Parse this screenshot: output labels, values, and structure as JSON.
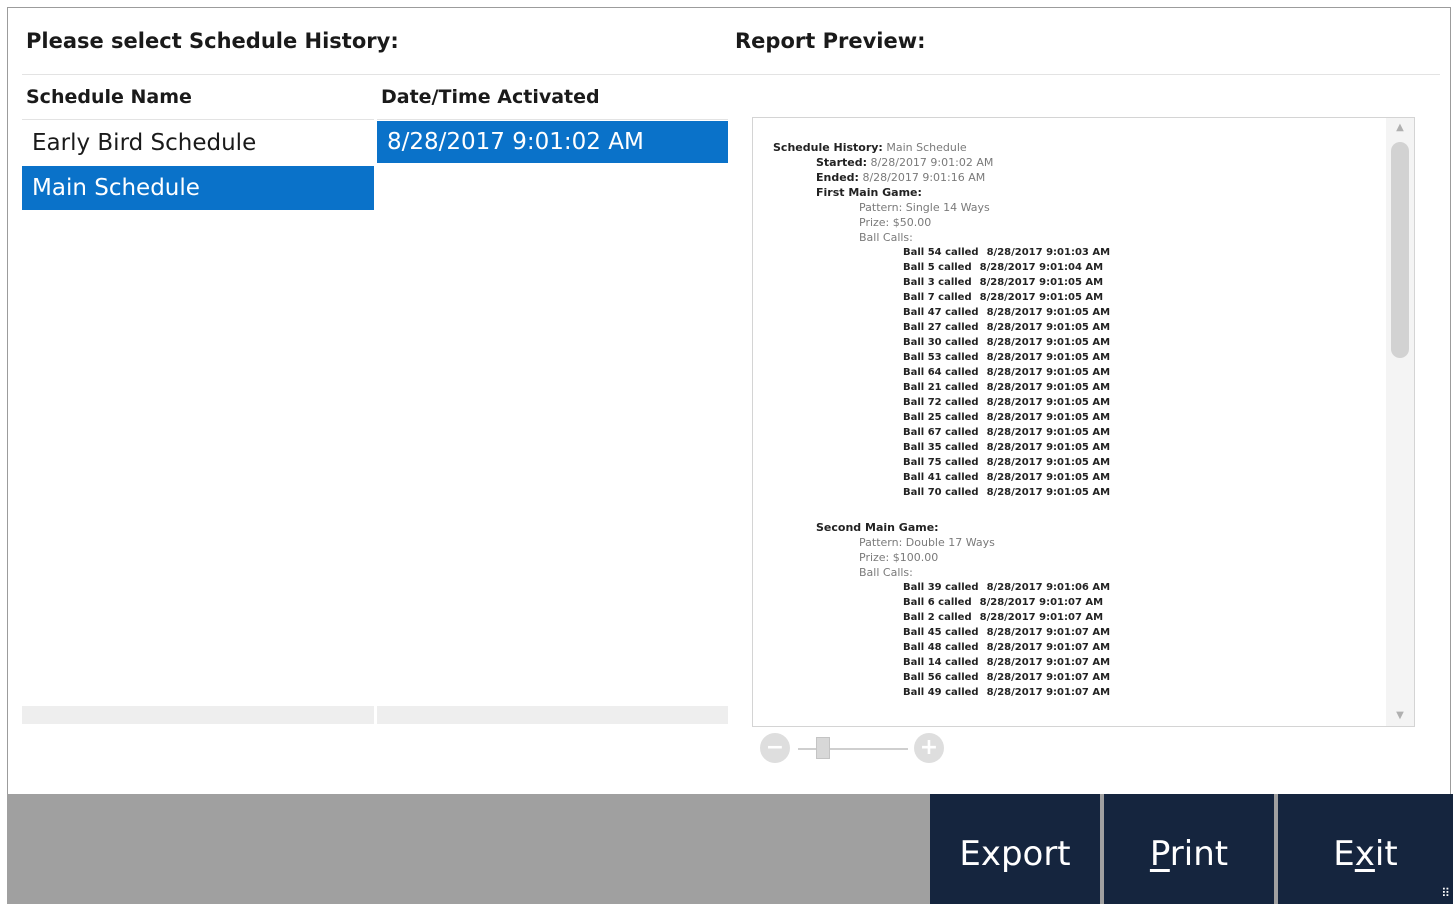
{
  "left_panel": {
    "title": "Please select Schedule History:",
    "columns": {
      "name": "Schedule Name",
      "date": "Date/Time Activated"
    },
    "schedules": [
      "Early Bird Schedule",
      "Main Schedule"
    ],
    "selected_schedule_index": 1,
    "activations": [
      "8/28/2017 9:01:02 AM"
    ],
    "selected_activation_index": 0
  },
  "preview": {
    "title": "Report Preview:",
    "report": {
      "history_label": "Schedule History:",
      "history_value": "Main Schedule",
      "started_label": "Started:",
      "started_value": "8/28/2017 9:01:02 AM",
      "ended_label": "Ended:",
      "ended_value": "8/28/2017 9:01:16 AM",
      "games": [
        {
          "title": "First Main Game:",
          "pattern": "Pattern: Single 14 Ways",
          "prize": "Prize: $50.00",
          "ball_calls_label": "Ball Calls:",
          "calls": [
            {
              "ball": "Ball 54 called",
              "time": "8/28/2017 9:01:03 AM"
            },
            {
              "ball": "Ball 5 called",
              "time": "8/28/2017 9:01:04 AM"
            },
            {
              "ball": "Ball 3 called",
              "time": "8/28/2017 9:01:05 AM"
            },
            {
              "ball": "Ball 7 called",
              "time": "8/28/2017 9:01:05 AM"
            },
            {
              "ball": "Ball 47 called",
              "time": "8/28/2017 9:01:05 AM"
            },
            {
              "ball": "Ball 27 called",
              "time": "8/28/2017 9:01:05 AM"
            },
            {
              "ball": "Ball 30 called",
              "time": "8/28/2017 9:01:05 AM"
            },
            {
              "ball": "Ball 53 called",
              "time": "8/28/2017 9:01:05 AM"
            },
            {
              "ball": "Ball 64 called",
              "time": "8/28/2017 9:01:05 AM"
            },
            {
              "ball": "Ball 21 called",
              "time": "8/28/2017 9:01:05 AM"
            },
            {
              "ball": "Ball 72 called",
              "time": "8/28/2017 9:01:05 AM"
            },
            {
              "ball": "Ball 25 called",
              "time": "8/28/2017 9:01:05 AM"
            },
            {
              "ball": "Ball 67 called",
              "time": "8/28/2017 9:01:05 AM"
            },
            {
              "ball": "Ball 35 called",
              "time": "8/28/2017 9:01:05 AM"
            },
            {
              "ball": "Ball 75 called",
              "time": "8/28/2017 9:01:05 AM"
            },
            {
              "ball": "Ball 41 called",
              "time": "8/28/2017 9:01:05 AM"
            },
            {
              "ball": "Ball 70 called",
              "time": "8/28/2017 9:01:05 AM"
            }
          ]
        },
        {
          "title": "Second Main Game:",
          "pattern": "Pattern: Double 17 Ways",
          "prize": "Prize: $100.00",
          "ball_calls_label": "Ball Calls:",
          "calls": [
            {
              "ball": "Ball 39 called",
              "time": "8/28/2017 9:01:06 AM"
            },
            {
              "ball": "Ball 6 called",
              "time": "8/28/2017 9:01:07 AM"
            },
            {
              "ball": "Ball 2 called",
              "time": "8/28/2017 9:01:07 AM"
            },
            {
              "ball": "Ball 45 called",
              "time": "8/28/2017 9:01:07 AM"
            },
            {
              "ball": "Ball 48 called",
              "time": "8/28/2017 9:01:07 AM"
            },
            {
              "ball": "Ball 14 called",
              "time": "8/28/2017 9:01:07 AM"
            },
            {
              "ball": "Ball 56 called",
              "time": "8/28/2017 9:01:07 AM"
            },
            {
              "ball": "Ball 49 called",
              "time": "8/28/2017 9:01:07 AM"
            }
          ]
        }
      ]
    },
    "zoom_out_icon": "minus-icon",
    "zoom_in_icon": "plus-icon"
  },
  "footer": {
    "export_label": "Export",
    "print_label": "Print",
    "exit_label": "Exit",
    "background": "#a0a0a0",
    "button_color": "#15253e"
  },
  "colors": {
    "selection": "#0a72c9"
  }
}
